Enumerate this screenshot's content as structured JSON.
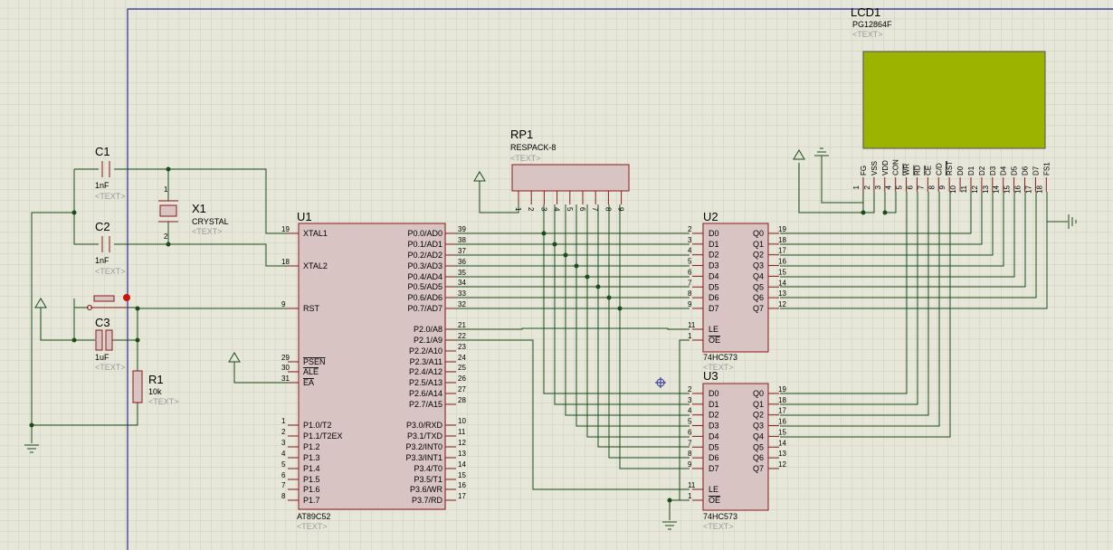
{
  "placeholder_text": "<TEXT>",
  "colors": {
    "background": "#e6e6d9",
    "grid": "#cdcdbf",
    "wire": "#1a4d1a",
    "component": "#8b1a1a",
    "lcd_screen": "#9cb400",
    "sheet_border": "#2a2a9a"
  },
  "components": {
    "c1": {
      "ref": "C1",
      "value": "1nF"
    },
    "c2": {
      "ref": "C2",
      "value": "1nF"
    },
    "c3": {
      "ref": "C3",
      "value": "1uF"
    },
    "x1": {
      "ref": "X1",
      "value": "CRYSTAL",
      "pin1": "1",
      "pin2": "2"
    },
    "r1": {
      "ref": "R1",
      "value": "10k"
    },
    "rp1": {
      "ref": "RP1",
      "value": "RESPACK-8",
      "pins": [
        "1",
        "2",
        "3",
        "4",
        "5",
        "6",
        "7",
        "8",
        "9"
      ]
    },
    "u1": {
      "ref": "U1",
      "value": "AT89C52",
      "left_pins": [
        {
          "num": "19",
          "name": "XTAL1"
        },
        {
          "num": "18",
          "name": "XTAL2"
        },
        {
          "num": "9",
          "name": "RST"
        },
        {
          "num": "29",
          "name": "PSEN"
        },
        {
          "num": "30",
          "name": "ALE"
        },
        {
          "num": "31",
          "name": "EA"
        },
        {
          "num": "1",
          "name": "P1.0/T2"
        },
        {
          "num": "2",
          "name": "P1.1/T2EX"
        },
        {
          "num": "3",
          "name": "P1.2"
        },
        {
          "num": "4",
          "name": "P1.3"
        },
        {
          "num": "5",
          "name": "P1.4"
        },
        {
          "num": "6",
          "name": "P1.5"
        },
        {
          "num": "7",
          "name": "P1.6"
        },
        {
          "num": "8",
          "name": "P1.7"
        }
      ],
      "right_pins": [
        {
          "num": "39",
          "name": "P0.0/AD0"
        },
        {
          "num": "38",
          "name": "P0.1/AD1"
        },
        {
          "num": "37",
          "name": "P0.2/AD2"
        },
        {
          "num": "36",
          "name": "P0.3/AD3"
        },
        {
          "num": "35",
          "name": "P0.4/AD4"
        },
        {
          "num": "34",
          "name": "P0.5/AD5"
        },
        {
          "num": "33",
          "name": "P0.6/AD6"
        },
        {
          "num": "32",
          "name": "P0.7/AD7"
        },
        {
          "num": "21",
          "name": "P2.0/A8"
        },
        {
          "num": "22",
          "name": "P2.1/A9"
        },
        {
          "num": "23",
          "name": "P2.2/A10"
        },
        {
          "num": "24",
          "name": "P2.3/A11"
        },
        {
          "num": "25",
          "name": "P2.4/A12"
        },
        {
          "num": "26",
          "name": "P2.5/A13"
        },
        {
          "num": "27",
          "name": "P2.6/A14"
        },
        {
          "num": "28",
          "name": "P2.7/A15"
        },
        {
          "num": "10",
          "name": "P3.0/RXD"
        },
        {
          "num": "11",
          "name": "P3.1/TXD"
        },
        {
          "num": "12",
          "name": "P3.2/INT0"
        },
        {
          "num": "13",
          "name": "P3.3/INT1"
        },
        {
          "num": "14",
          "name": "P3.4/T0"
        },
        {
          "num": "15",
          "name": "P3.5/T1"
        },
        {
          "num": "16",
          "name": "P3.6/WR"
        },
        {
          "num": "17",
          "name": "P3.7/RD"
        }
      ]
    },
    "u2": {
      "ref": "U2",
      "value": "74HC573",
      "d_pins": [
        {
          "num": "2",
          "name": "D0"
        },
        {
          "num": "3",
          "name": "D1"
        },
        {
          "num": "4",
          "name": "D2"
        },
        {
          "num": "5",
          "name": "D3"
        },
        {
          "num": "6",
          "name": "D4"
        },
        {
          "num": "7",
          "name": "D5"
        },
        {
          "num": "8",
          "name": "D6"
        },
        {
          "num": "9",
          "name": "D7"
        }
      ],
      "q_pins": [
        {
          "num": "19",
          "name": "Q0"
        },
        {
          "num": "18",
          "name": "Q1"
        },
        {
          "num": "17",
          "name": "Q2"
        },
        {
          "num": "16",
          "name": "Q3"
        },
        {
          "num": "15",
          "name": "Q4"
        },
        {
          "num": "14",
          "name": "Q5"
        },
        {
          "num": "13",
          "name": "Q6"
        },
        {
          "num": "12",
          "name": "Q7"
        }
      ],
      "ctrl_pins": [
        {
          "num": "11",
          "name": "LE"
        },
        {
          "num": "1",
          "name": "OE"
        }
      ]
    },
    "u3": {
      "ref": "U3",
      "value": "74HC573",
      "d_pins": [
        {
          "num": "2",
          "name": "D0"
        },
        {
          "num": "3",
          "name": "D1"
        },
        {
          "num": "4",
          "name": "D2"
        },
        {
          "num": "5",
          "name": "D3"
        },
        {
          "num": "6",
          "name": "D4"
        },
        {
          "num": "7",
          "name": "D5"
        },
        {
          "num": "8",
          "name": "D6"
        },
        {
          "num": "9",
          "name": "D7"
        }
      ],
      "q_pins": [
        {
          "num": "19",
          "name": "Q0"
        },
        {
          "num": "18",
          "name": "Q1"
        },
        {
          "num": "17",
          "name": "Q2"
        },
        {
          "num": "16",
          "name": "Q3"
        },
        {
          "num": "15",
          "name": "Q4"
        },
        {
          "num": "14",
          "name": "Q5"
        },
        {
          "num": "13",
          "name": "Q6"
        },
        {
          "num": "12",
          "name": "Q7"
        }
      ],
      "ctrl_pins": [
        {
          "num": "11",
          "name": "LE"
        },
        {
          "num": "1",
          "name": "OE"
        }
      ]
    },
    "lcd1": {
      "ref": "LCD1",
      "value": "PG12864F",
      "pins": [
        {
          "num": "1",
          "name": "FG"
        },
        {
          "num": "2",
          "name": "VSS"
        },
        {
          "num": "3",
          "name": "VDD"
        },
        {
          "num": "4",
          "name": "CON"
        },
        {
          "num": "5",
          "name": "WR"
        },
        {
          "num": "6",
          "name": "RD"
        },
        {
          "num": "7",
          "name": "CE"
        },
        {
          "num": "8",
          "name": "C/D"
        },
        {
          "num": "9",
          "name": "RST"
        },
        {
          "num": "10",
          "name": "D0"
        },
        {
          "num": "11",
          "name": "D1"
        },
        {
          "num": "12",
          "name": "D2"
        },
        {
          "num": "13",
          "name": "D3"
        },
        {
          "num": "14",
          "name": "D4"
        },
        {
          "num": "15",
          "name": "D5"
        },
        {
          "num": "16",
          "name": "D6"
        },
        {
          "num": "17",
          "name": "D7"
        },
        {
          "num": "18",
          "name": "FS1"
        }
      ]
    }
  }
}
